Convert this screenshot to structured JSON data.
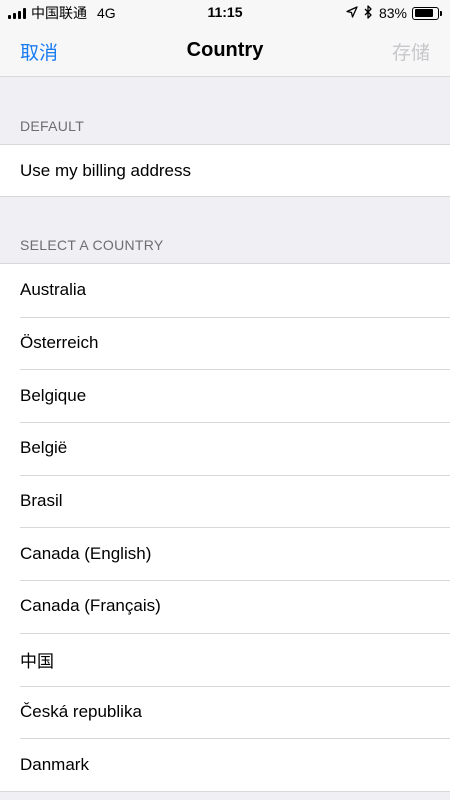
{
  "status_bar": {
    "carrier": "中国联通",
    "network": "4G",
    "time": "11:15",
    "location_icon": "location-arrow-icon",
    "bluetooth_icon": "bluetooth-icon",
    "battery_percent": "83%",
    "battery_level": 0.83
  },
  "nav": {
    "cancel_label": "取消",
    "title": "Country",
    "save_label": "存储"
  },
  "sections": {
    "default_header": "DEFAULT",
    "default_item": "Use my billing address",
    "countries_header": "SELECT A COUNTRY"
  },
  "countries": [
    "Australia",
    "Österreich",
    "Belgique",
    "België",
    "Brasil",
    "Canada (English)",
    "Canada (Français)",
    "中国",
    "Česká republika",
    "Danmark"
  ],
  "colors": {
    "accent": "#1a7cf2",
    "disabled": "#c7c7cc",
    "grouped_background": "#efeff4",
    "section_header_text": "#6d6d72"
  }
}
